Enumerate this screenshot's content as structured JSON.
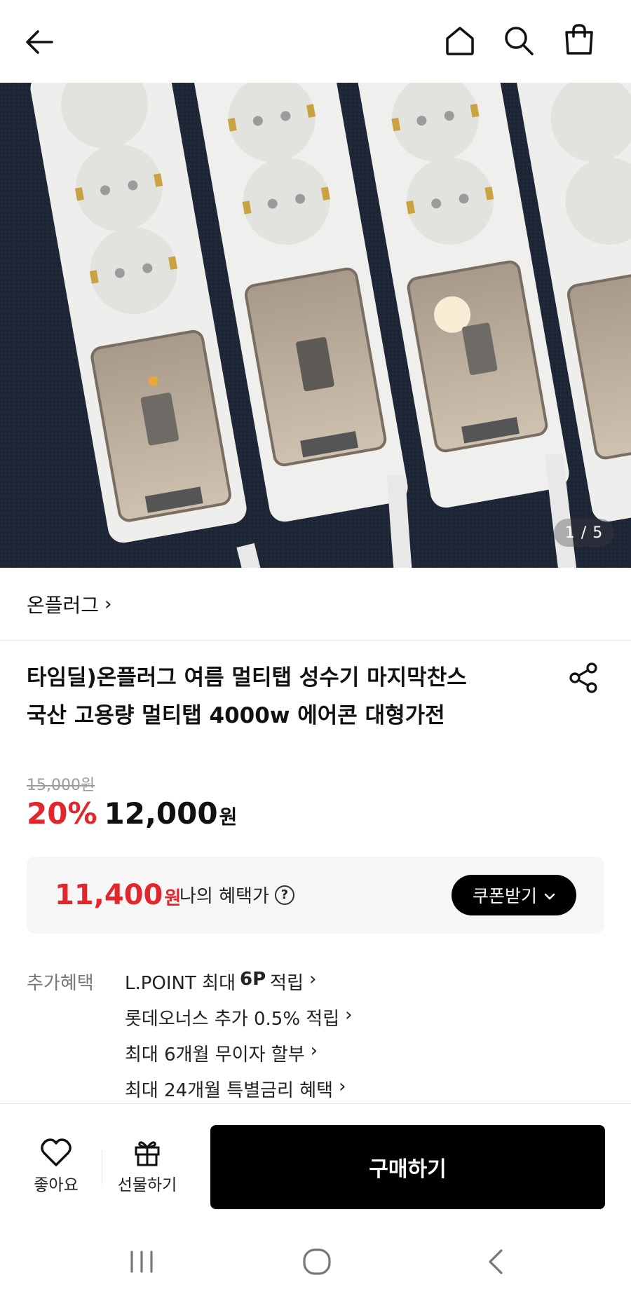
{
  "header": {
    "back_icon": "arrow-left-icon",
    "home_icon": "home-icon",
    "search_icon": "search-icon",
    "cart_icon": "shopping-bag-icon"
  },
  "gallery": {
    "pager": "1 / 5",
    "current_page": 1,
    "total_pages": 5
  },
  "product": {
    "brand": "온플러그",
    "title_line1": "타임딜)온플러그 여름 멀티탭 성수기 마지막찬스",
    "title_line2": "국산 고용량 멀티탭 4000w 에어콘 대형가전",
    "original_price": "15,000원",
    "discount": "20%",
    "price": "12,000",
    "price_unit": "원"
  },
  "benefit": {
    "price": "11,400",
    "unit": "원",
    "label": "나의 혜택가",
    "help": "?",
    "coupon_button": "쿠폰받기"
  },
  "extra": {
    "label": "추가혜택",
    "items": [
      {
        "pre": "L.POINT 최대",
        "bold": "6P",
        "post": "적립"
      },
      {
        "text": "롯데오너스 추가 0.5% 적립"
      },
      {
        "text": "최대 6개월 무이자 할부"
      },
      {
        "text": "최대 24개월 특별금리 혜택"
      }
    ],
    "chevron": "›"
  },
  "bottom": {
    "like_label": "좋아요",
    "gift_label": "선물하기",
    "buy_label": "구매하기"
  },
  "colors": {
    "accent_red": "#e3262b",
    "black": "#000000",
    "benefit_bg": "#f6f6f6"
  }
}
